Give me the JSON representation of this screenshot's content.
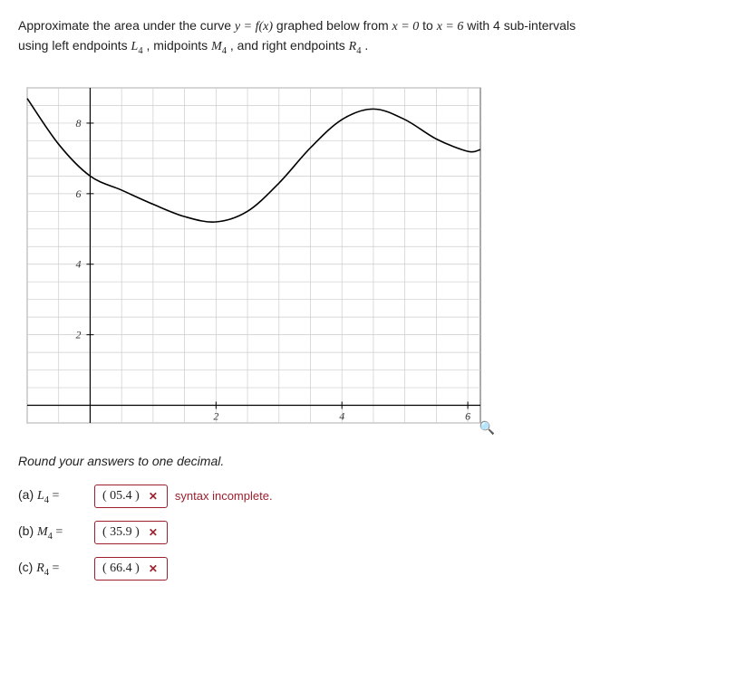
{
  "prompt": {
    "line1a": "Approximate the area under the curve ",
    "eq1": "y = f(x)",
    "line1b": " graphed below from ",
    "eq2": "x = 0",
    "line1c": " to ",
    "eq3": "x = 6",
    "line1d": " with 4 sub-intervals",
    "line2a": "using left endpoints ",
    "L4": "L",
    "L4sub": "4",
    "comma1": ", midpoints ",
    "M4": "M",
    "M4sub": "4",
    "comma2": ", and right endpoints ",
    "R4": "R",
    "R4sub": "4",
    "period": "."
  },
  "round_note": "Round your answers to one decimal.",
  "answers": {
    "a": {
      "label_prefix": "(a) ",
      "sym": "L",
      "sub": "4",
      "eq": " = ",
      "value": "( 05.4 )",
      "feedback": "syntax incomplete."
    },
    "b": {
      "label_prefix": "(b) ",
      "sym": "M",
      "sub": "4",
      "eq": " = ",
      "value": "( 35.9 )",
      "feedback": ""
    },
    "c": {
      "label_prefix": "(c) ",
      "sym": "R",
      "sub": "4",
      "eq": " = ",
      "value": "( 66.4 )",
      "feedback": ""
    }
  },
  "chart_data": {
    "type": "line",
    "title": "",
    "xlabel": "",
    "ylabel": "",
    "xlim": [
      -1,
      6.2
    ],
    "ylim": [
      -0.5,
      9
    ],
    "xticks": [
      2,
      4,
      6
    ],
    "yticks": [
      2,
      4,
      6,
      8
    ],
    "series": [
      {
        "name": "f(x)",
        "x": [
          -1,
          -0.5,
          0,
          0.5,
          1,
          1.5,
          2,
          2.5,
          3,
          3.5,
          4,
          4.5,
          5,
          5.5,
          6,
          6.2
        ],
        "values": [
          8.7,
          7.4,
          6.5,
          6.1,
          5.7,
          5.35,
          5.2,
          5.5,
          6.3,
          7.3,
          8.1,
          8.4,
          8.1,
          7.55,
          7.2,
          7.25
        ]
      }
    ]
  },
  "icons": {
    "wrong": "✕",
    "magnify": "🔍"
  }
}
